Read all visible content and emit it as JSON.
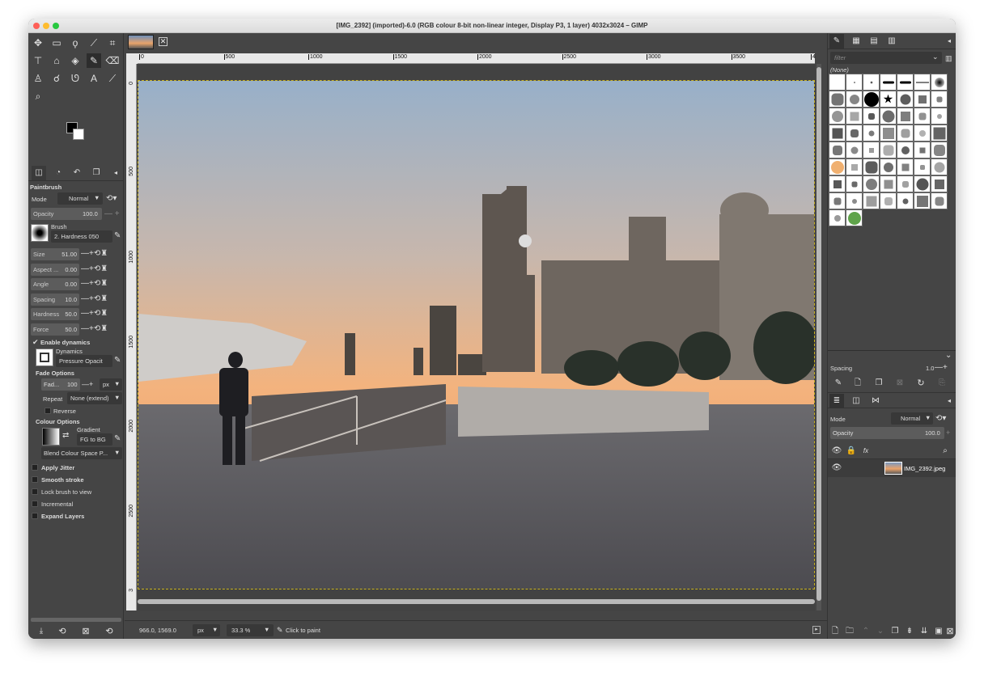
{
  "window": {
    "title": "[IMG_2392] (imported)-6.0 (RGB colour 8-bit non-linear integer, Display P3, 1 layer) 4032x3024 – GIMP"
  },
  "toolbox": {
    "tools": [
      "move-icon",
      "rect-select-icon",
      "free-select-icon",
      "fuzzy-select-icon",
      "crop-icon",
      "transform-icon",
      "warp-icon",
      "bucket-fill-icon",
      "paintbrush-icon",
      "eraser-icon",
      "clone-icon",
      "smudge-icon",
      "path-icon",
      "text-icon",
      "color-picker-icon",
      "zoom-icon"
    ]
  },
  "tool_options": {
    "title": "Paintbrush",
    "mode_label": "Mode",
    "mode_value": "Normal",
    "opacity_label": "Opacity",
    "opacity_value": "100.0",
    "brush_label": "Brush",
    "brush_value": "2. Hardness 050",
    "size_label": "Size",
    "size_value": "51.00",
    "aspect_label": "Aspect ...",
    "aspect_value": "0.00",
    "angle_label": "Angle",
    "angle_value": "0.00",
    "spacing_label": "Spacing",
    "spacing_value": "10.0",
    "hardness_label": "Hardness",
    "hardness_value": "50.0",
    "force_label": "Force",
    "force_value": "50.0",
    "enable_dynamics": "Enable dynamics",
    "dynamics_label": "Dynamics",
    "dynamics_value": "Pressure Opacit",
    "fade_options": "Fade Options",
    "fade_label": "Fad...",
    "fade_value": "100",
    "fade_unit": "px",
    "repeat_label": "Repeat",
    "repeat_value": "None (extend)",
    "reverse": "Reverse",
    "colour_options": "Colour Options",
    "gradient_label": "Gradient",
    "gradient_value": "FG to BG",
    "blend_value": "Blend Colour Space P...",
    "apply_jitter": "Apply Jitter",
    "smooth_stroke": "Smooth stroke",
    "lock_brush": "Lock brush to view",
    "incremental": "Incremental",
    "expand_layers": "Expand Layers"
  },
  "ruler_h": [
    "0",
    "500",
    "1000",
    "1500",
    "2000",
    "2500",
    "3000",
    "3500",
    "4"
  ],
  "ruler_v": [
    "0",
    "500",
    "1000",
    "1500",
    "2000",
    "2500",
    "3"
  ],
  "status": {
    "coords": "966.0, 1569.0",
    "unit": "px",
    "zoom": "33.3 %",
    "message": "Click to paint"
  },
  "brushes_panel": {
    "filter_placeholder": "filter",
    "selected": "(None)",
    "spacing_label": "Spacing",
    "spacing_value": "1.0"
  },
  "layers_panel": {
    "mode_label": "Mode",
    "mode_value": "Normal",
    "opacity_label": "Opacity",
    "opacity_value": "100.0",
    "layer_name": "IMG_2392.jpeg"
  }
}
